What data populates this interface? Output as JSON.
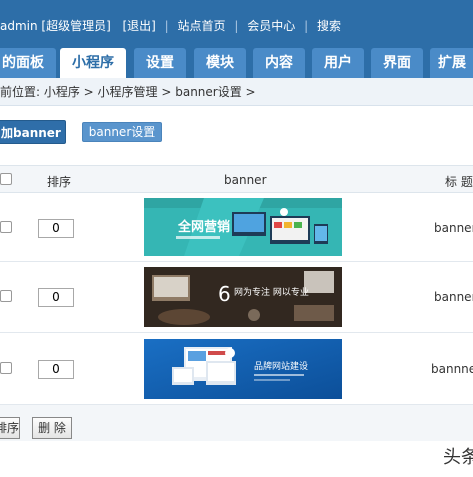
{
  "topbar": {
    "user": "admin [超级管理员]",
    "logout": "[退出]",
    "home": "站点首页",
    "member": "会员中心",
    "search": "搜索"
  },
  "tabs": [
    {
      "label": "的面板"
    },
    {
      "label": "小程序"
    },
    {
      "label": "设置"
    },
    {
      "label": "模块"
    },
    {
      "label": "内容"
    },
    {
      "label": "用户"
    },
    {
      "label": "界面"
    },
    {
      "label": "扩展"
    }
  ],
  "breadcrumb": "前位置: 小程序 > 小程序管理 > banner设置 >",
  "actions": {
    "add": "加banner",
    "settings": "banner设置"
  },
  "table": {
    "headers": {
      "order": "排序",
      "banner": "banner",
      "title": "标 题"
    },
    "rows": [
      {
        "order": "0",
        "banner_text": "全网营销",
        "title": "banner"
      },
      {
        "order": "0",
        "banner_text": "网为专注 网以专业",
        "title": "banner"
      },
      {
        "order": "0",
        "banner_text": "品牌网站建设",
        "title": "bannne"
      }
    ]
  },
  "footer": {
    "sort_button": "排序",
    "delete_button": "删 除"
  },
  "watermark": "头条",
  "colors": {
    "brand": "#2d6ea8",
    "tab": "#4a8bc8",
    "active_tab_text": "#2d6ea8"
  }
}
